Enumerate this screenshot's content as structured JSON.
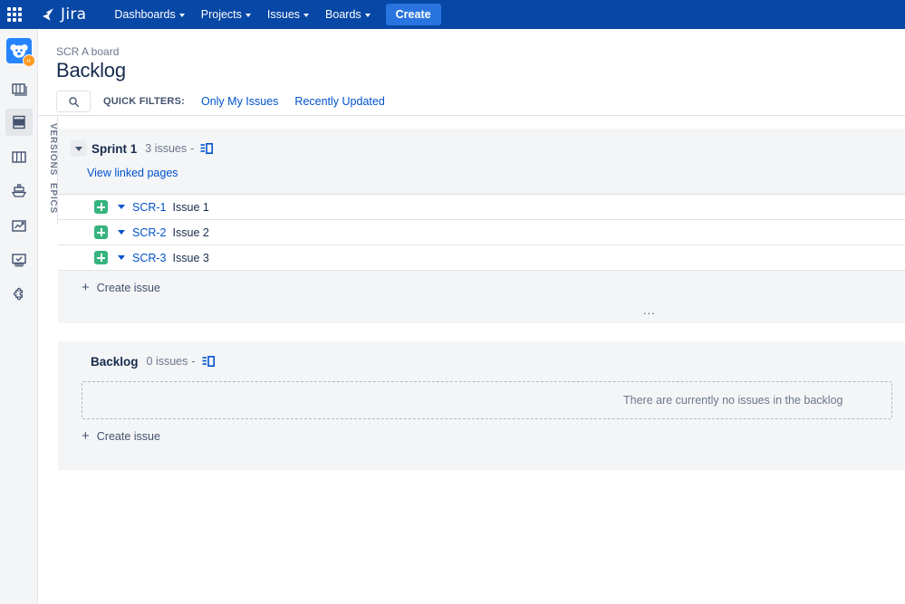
{
  "topnav": {
    "app_switcher_icon": "grid-apps-icon",
    "logo_text": "Jira",
    "items": [
      {
        "label": "Dashboards",
        "icon": "chevron-down-icon"
      },
      {
        "label": "Projects",
        "icon": "chevron-down-icon"
      },
      {
        "label": "Issues",
        "icon": "chevron-down-icon"
      },
      {
        "label": "Boards",
        "icon": "chevron-down-icon"
      }
    ],
    "create_label": "Create",
    "bar_color": "#0747A6",
    "create_color": "#2a74e0"
  },
  "rail": {
    "project_avatar": {
      "name": "project-avatar",
      "badge": "‹›",
      "color": "#2684FF",
      "badge_color": "#FF991F"
    },
    "items": [
      {
        "name": "backlog-stack-icon",
        "selected": false
      },
      {
        "name": "sprint-backlog-icon",
        "selected": true
      },
      {
        "name": "board-columns-icon",
        "selected": false
      },
      {
        "name": "releases-ship-icon",
        "selected": false
      },
      {
        "name": "reports-chart-icon",
        "selected": false
      },
      {
        "name": "issues-checklist-icon",
        "selected": false
      },
      {
        "name": "addons-puzzle-icon",
        "selected": false
      }
    ]
  },
  "sidetabs": {
    "versions": "VERSIONS",
    "epics": "EPICS"
  },
  "header": {
    "breadcrumb": "SCR A board",
    "title": "Backlog",
    "search_icon": "search-icon",
    "quick_filters_label": "QUICK FILTERS:",
    "quick_filters": [
      {
        "label": "Only My Issues"
      },
      {
        "label": "Recently Updated"
      }
    ],
    "link_color": "#0052CC"
  },
  "sprint": {
    "name": "Sprint 1",
    "count": "3 issues",
    "count_separator": "-",
    "estimate_icon": "estimate-board-icon",
    "chevron_icon": "chevron-down-icon",
    "view_linked_pages": "View linked pages",
    "create_issue": "Create issue",
    "more_icon": "more-options-ellipsis-icon",
    "more_glyph": "...",
    "issues": [
      {
        "key": "SCR-1",
        "summary": "Issue 1",
        "type": "task",
        "type_color": "#36B37E"
      },
      {
        "key": "SCR-2",
        "summary": "Issue 2",
        "type": "task",
        "type_color": "#36B37E"
      },
      {
        "key": "SCR-3",
        "summary": "Issue 3",
        "type": "task",
        "type_color": "#36B37E"
      }
    ]
  },
  "backlog": {
    "name": "Backlog",
    "count": "0 issues",
    "count_separator": "-",
    "estimate_icon": "estimate-board-icon",
    "empty_text": "There are currently no issues in the backlog",
    "create_issue": "Create issue"
  }
}
